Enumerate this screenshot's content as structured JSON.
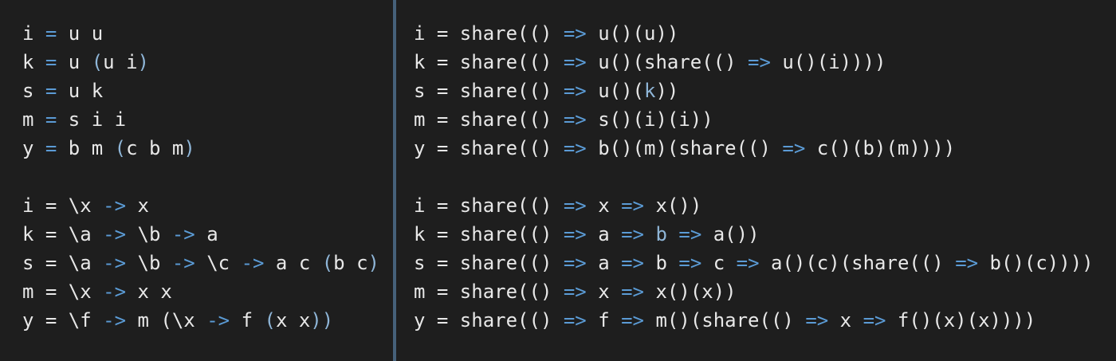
{
  "colors": {
    "background": "#1e1e1e",
    "divider": "#46617a",
    "text": "#e8e8e8",
    "operator": "#5b9bd5",
    "paren": "#8fb6d8"
  },
  "left_pane": {
    "lines": [
      [
        {
          "t": "i ",
          "k": "n"
        },
        {
          "t": "=",
          "k": "op"
        },
        {
          "t": " u u",
          "k": "n"
        }
      ],
      [
        {
          "t": "k ",
          "k": "n"
        },
        {
          "t": "=",
          "k": "op"
        },
        {
          "t": " u ",
          "k": "n"
        },
        {
          "t": "(",
          "k": "p"
        },
        {
          "t": "u i",
          "k": "n"
        },
        {
          "t": ")",
          "k": "p"
        }
      ],
      [
        {
          "t": "s ",
          "k": "n"
        },
        {
          "t": "=",
          "k": "op"
        },
        {
          "t": " u k",
          "k": "n"
        }
      ],
      [
        {
          "t": "m ",
          "k": "n"
        },
        {
          "t": "=",
          "k": "op"
        },
        {
          "t": " s i i",
          "k": "n"
        }
      ],
      [
        {
          "t": "y ",
          "k": "n"
        },
        {
          "t": "=",
          "k": "op"
        },
        {
          "t": " b m ",
          "k": "n"
        },
        {
          "t": "(",
          "k": "p"
        },
        {
          "t": "c b m",
          "k": "n"
        },
        {
          "t": ")",
          "k": "p"
        }
      ],
      [],
      [
        {
          "t": "i = \\x ",
          "k": "n"
        },
        {
          "t": "->",
          "k": "op"
        },
        {
          "t": " x",
          "k": "n"
        }
      ],
      [
        {
          "t": "k = \\a ",
          "k": "n"
        },
        {
          "t": "->",
          "k": "op"
        },
        {
          "t": " \\b ",
          "k": "n"
        },
        {
          "t": "->",
          "k": "op"
        },
        {
          "t": " a",
          "k": "n"
        }
      ],
      [
        {
          "t": "s = \\a ",
          "k": "n"
        },
        {
          "t": "->",
          "k": "op"
        },
        {
          "t": " \\b ",
          "k": "n"
        },
        {
          "t": "->",
          "k": "op"
        },
        {
          "t": " \\c ",
          "k": "n"
        },
        {
          "t": "->",
          "k": "op"
        },
        {
          "t": " a c ",
          "k": "n"
        },
        {
          "t": "(",
          "k": "p"
        },
        {
          "t": "b c",
          "k": "n"
        },
        {
          "t": ")",
          "k": "p"
        }
      ],
      [
        {
          "t": "m = \\x ",
          "k": "n"
        },
        {
          "t": "->",
          "k": "op"
        },
        {
          "t": " x x",
          "k": "n"
        }
      ],
      [
        {
          "t": "y = \\f ",
          "k": "n"
        },
        {
          "t": "->",
          "k": "op"
        },
        {
          "t": " m (\\x ",
          "k": "n"
        },
        {
          "t": "->",
          "k": "op"
        },
        {
          "t": " f ",
          "k": "n"
        },
        {
          "t": "(",
          "k": "p"
        },
        {
          "t": "x x",
          "k": "n"
        },
        {
          "t": "))",
          "k": "p"
        }
      ]
    ]
  },
  "right_pane": {
    "lines": [
      [
        {
          "t": "i = share(() ",
          "k": "n"
        },
        {
          "t": "=>",
          "k": "op"
        },
        {
          "t": " u()(u))",
          "k": "n"
        }
      ],
      [
        {
          "t": "k = share(() ",
          "k": "n"
        },
        {
          "t": "=>",
          "k": "op"
        },
        {
          "t": " u()(share(() ",
          "k": "n"
        },
        {
          "t": "=>",
          "k": "op"
        },
        {
          "t": " u()(i))))",
          "k": "n"
        }
      ],
      [
        {
          "t": "s = share(() ",
          "k": "n"
        },
        {
          "t": "=>",
          "k": "op"
        },
        {
          "t": " u()(",
          "k": "n"
        },
        {
          "t": "k",
          "k": "p"
        },
        {
          "t": "))",
          "k": "n"
        }
      ],
      [
        {
          "t": "m = share(() ",
          "k": "n"
        },
        {
          "t": "=>",
          "k": "op"
        },
        {
          "t": " s()(i)(i))",
          "k": "n"
        }
      ],
      [
        {
          "t": "y = share(() ",
          "k": "n"
        },
        {
          "t": "=>",
          "k": "op"
        },
        {
          "t": " b()(m)(share(() ",
          "k": "n"
        },
        {
          "t": "=>",
          "k": "op"
        },
        {
          "t": " c()(b)(m))))",
          "k": "n"
        }
      ],
      [],
      [
        {
          "t": "i = share(() ",
          "k": "n"
        },
        {
          "t": "=>",
          "k": "op"
        },
        {
          "t": " x ",
          "k": "n"
        },
        {
          "t": "=>",
          "k": "op"
        },
        {
          "t": " x())",
          "k": "n"
        }
      ],
      [
        {
          "t": "k = share(() ",
          "k": "n"
        },
        {
          "t": "=>",
          "k": "op"
        },
        {
          "t": " a ",
          "k": "n"
        },
        {
          "t": "=>",
          "k": "op"
        },
        {
          "t": " ",
          "k": "n"
        },
        {
          "t": "b",
          "k": "p"
        },
        {
          "t": " ",
          "k": "n"
        },
        {
          "t": "=>",
          "k": "op"
        },
        {
          "t": " a())",
          "k": "n"
        }
      ],
      [
        {
          "t": "s = share(() ",
          "k": "n"
        },
        {
          "t": "=>",
          "k": "op"
        },
        {
          "t": " a ",
          "k": "n"
        },
        {
          "t": "=>",
          "k": "op"
        },
        {
          "t": " b ",
          "k": "n"
        },
        {
          "t": "=>",
          "k": "op"
        },
        {
          "t": " c ",
          "k": "n"
        },
        {
          "t": "=>",
          "k": "op"
        },
        {
          "t": " a()(c)(share(() ",
          "k": "n"
        },
        {
          "t": "=>",
          "k": "op"
        },
        {
          "t": " b()(c))))",
          "k": "n"
        }
      ],
      [
        {
          "t": "m = share(() ",
          "k": "n"
        },
        {
          "t": "=>",
          "k": "op"
        },
        {
          "t": " x ",
          "k": "n"
        },
        {
          "t": "=>",
          "k": "op"
        },
        {
          "t": " x()(x))",
          "k": "n"
        }
      ],
      [
        {
          "t": "y = share(() ",
          "k": "n"
        },
        {
          "t": "=>",
          "k": "op"
        },
        {
          "t": " f ",
          "k": "n"
        },
        {
          "t": "=>",
          "k": "op"
        },
        {
          "t": " m()(share(() ",
          "k": "n"
        },
        {
          "t": "=>",
          "k": "op"
        },
        {
          "t": " x ",
          "k": "n"
        },
        {
          "t": "=>",
          "k": "op"
        },
        {
          "t": " f()(x)(x))))",
          "k": "n"
        }
      ]
    ]
  }
}
